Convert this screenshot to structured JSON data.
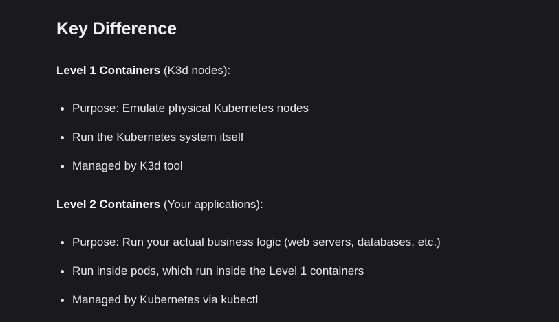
{
  "heading": "Key Difference",
  "sections": [
    {
      "title": "Level 1 Containers",
      "note": " (K3d nodes):",
      "items": [
        "Purpose: Emulate physical Kubernetes nodes",
        "Run the Kubernetes system itself",
        "Managed by K3d tool"
      ]
    },
    {
      "title": "Level 2 Containers",
      "note": " (Your applications):",
      "items": [
        "Purpose: Run your actual business logic (web servers, databases, etc.)",
        "Run inside pods, which run inside the Level 1 containers",
        "Managed by Kubernetes via kubectl"
      ]
    }
  ]
}
